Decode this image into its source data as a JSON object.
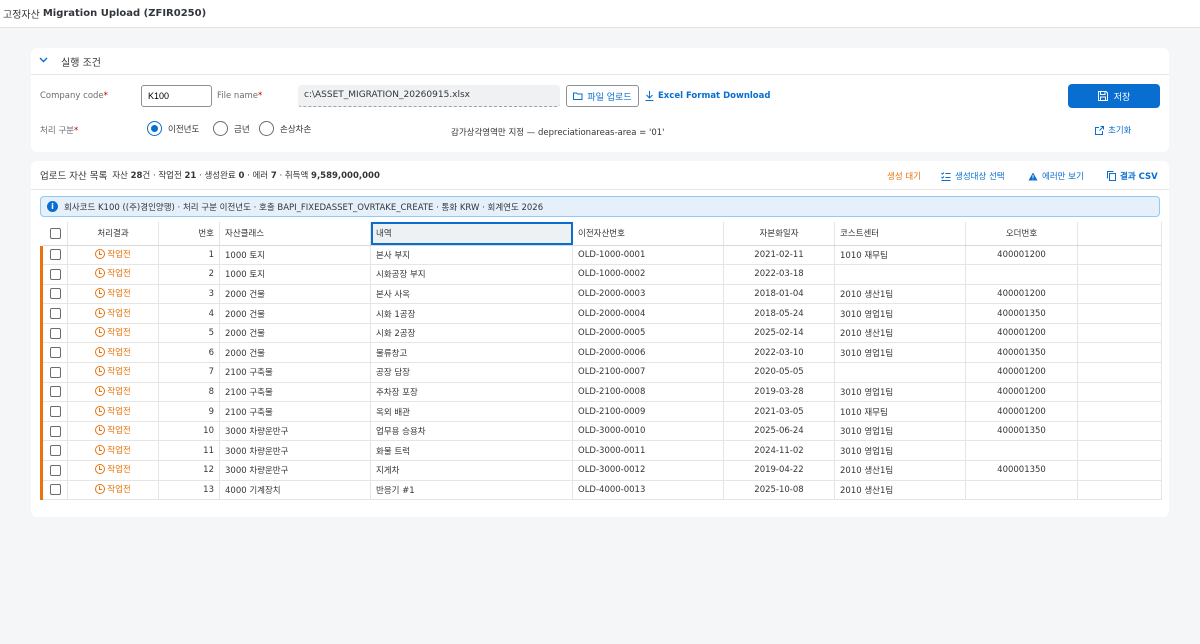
{
  "header": {
    "title_ko": "고정자산",
    "title_rest": "Migration Upload (ZFIR0250)"
  },
  "criteria": {
    "title": "실행 조건",
    "company_code_label": "Company code",
    "company_code_value": "K100",
    "file_name_label": "File name",
    "file_name_value": "c:\\ASSET_MIGRATION_20260915.xlsx",
    "upload_label": "파일 업로드",
    "excel_download_label": "Excel Format Download",
    "save_label": "저장",
    "process_type_label": "처리 구분",
    "radio_options": [
      "이전년도",
      "금년",
      "손상차손"
    ],
    "radio_selected": 0,
    "depr_note": "감가상각영역만 지정 — depreciationareas-area = '01'",
    "reset_label": "초기화"
  },
  "list": {
    "title": "업로드 자산 목록",
    "summary": {
      "p1": "자산 ",
      "v1": "28",
      "p2": "건 · 작업전 ",
      "v2": "21",
      "p3": " · 생성완료 ",
      "v3": "0",
      "p4": " · 에러 ",
      "v4": "7",
      "p5": " · 취득액 ",
      "v5": "9,589,000,000"
    },
    "actions": {
      "pending": "생성 대기",
      "select": "생성대상 선택",
      "errors_only": "에러만 보기",
      "csv": "결과 CSV"
    },
    "info_text": "회사코드 K100 ((주)경인양행) · 처리 구분 이전년도 · 호출 BAPI_FIXEDASSET_OVRTAKE_CREATE · 통화 KRW · 회계연도 2026",
    "columns": [
      "처리결과",
      "번호",
      "자산클래스",
      "내역",
      "이전자산번호",
      "자본화일자",
      "코스트센터",
      "오더번호"
    ],
    "rows": [
      {
        "status": "작업전",
        "no": "1",
        "cls": "1000 토지",
        "desc": "본사 부지",
        "old": "OLD-1000-0001",
        "date": "2021-02-11",
        "cc": "1010 재무팀",
        "order": "400001200"
      },
      {
        "status": "작업전",
        "no": "2",
        "cls": "1000 토지",
        "desc": "시화공장 부지",
        "old": "OLD-1000-0002",
        "date": "2022-03-18",
        "cc": "",
        "order": ""
      },
      {
        "status": "작업전",
        "no": "3",
        "cls": "2000 건물",
        "desc": "본사 사옥",
        "old": "OLD-2000-0003",
        "date": "2018-01-04",
        "cc": "2010 생산1팀",
        "order": "400001200"
      },
      {
        "status": "작업전",
        "no": "4",
        "cls": "2000 건물",
        "desc": "시화 1공장",
        "old": "OLD-2000-0004",
        "date": "2018-05-24",
        "cc": "3010 영업1팀",
        "order": "400001350"
      },
      {
        "status": "작업전",
        "no": "5",
        "cls": "2000 건물",
        "desc": "시화 2공장",
        "old": "OLD-2000-0005",
        "date": "2025-02-14",
        "cc": "2010 생산1팀",
        "order": "400001200"
      },
      {
        "status": "작업전",
        "no": "6",
        "cls": "2000 건물",
        "desc": "물류창고",
        "old": "OLD-2000-0006",
        "date": "2022-03-10",
        "cc": "3010 영업1팀",
        "order": "400001350"
      },
      {
        "status": "작업전",
        "no": "7",
        "cls": "2100 구축물",
        "desc": "공장 담장",
        "old": "OLD-2100-0007",
        "date": "2020-05-05",
        "cc": "",
        "order": "400001200"
      },
      {
        "status": "작업전",
        "no": "8",
        "cls": "2100 구축물",
        "desc": "주차장 포장",
        "old": "OLD-2100-0008",
        "date": "2019-03-28",
        "cc": "3010 영업1팀",
        "order": "400001200"
      },
      {
        "status": "작업전",
        "no": "9",
        "cls": "2100 구축물",
        "desc": "옥외 배관",
        "old": "OLD-2100-0009",
        "date": "2021-03-05",
        "cc": "1010 재무팀",
        "order": "400001200"
      },
      {
        "status": "작업전",
        "no": "10",
        "cls": "3000 차량운반구",
        "desc": "업무용 승용차",
        "old": "OLD-3000-0010",
        "date": "2025-06-24",
        "cc": "3010 영업1팀",
        "order": "400001350"
      },
      {
        "status": "작업전",
        "no": "11",
        "cls": "3000 차량운반구",
        "desc": "화물 트럭",
        "old": "OLD-3000-0011",
        "date": "2024-11-02",
        "cc": "3010 영업1팀",
        "order": ""
      },
      {
        "status": "작업전",
        "no": "12",
        "cls": "3000 차량운반구",
        "desc": "지게차",
        "old": "OLD-3000-0012",
        "date": "2019-04-22",
        "cc": "2010 생산1팀",
        "order": "400001350"
      },
      {
        "status": "작업전",
        "no": "13",
        "cls": "4000 기계장치",
        "desc": "반응기 #1",
        "old": "OLD-4000-0013",
        "date": "2025-10-08",
        "cc": "2010 생산1팀",
        "order": ""
      }
    ]
  }
}
